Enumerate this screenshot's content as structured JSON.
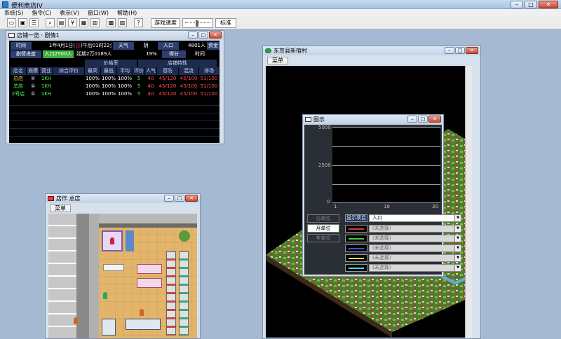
{
  "app": {
    "title": "便利商店IV"
  },
  "menu": [
    "系统(S)",
    "指令(C)",
    "表示(V)",
    "窗口(W)",
    "帮助(H)"
  ],
  "toolbar": {
    "icons": [
      "new-file-icon",
      "save-icon",
      "stats-icon",
      "search-icon",
      "card-icon",
      "money-icon",
      "register-icon",
      "calendar-icon",
      "chart-icon",
      "image-icon",
      "help-icon"
    ],
    "speed_label": "游戏速度",
    "speed_value": "标准",
    "help_glyph": "?"
  },
  "store_list": {
    "title": "店铺一览 · 剧情1",
    "row1": {
      "time_label": "时间",
      "date": "1年4月1日(",
      "weekday": "日",
      "time": ")午后01时22分",
      "weather_label": "天气",
      "weather": "阴",
      "pop_label": "人口",
      "pop": "4801人",
      "fund_label": "资金"
    },
    "row2": {
      "progress_label": "剧情进度",
      "progress_text": "入口2500人",
      "target": "延期2万0189人",
      "pct": "19%",
      "score_label": "得分",
      "time2_label": "时间"
    },
    "group1": "价格率",
    "group2": "店铺特性",
    "columns": [
      "店名",
      "规模",
      "营业",
      "综合评价",
      "最高",
      "最低",
      "平均",
      "评价",
      "人气",
      "容防",
      "混流",
      "排场"
    ],
    "rows": [
      [
        "总店",
        "①",
        "1KH",
        "",
        "100%",
        "100%",
        "100%",
        "5",
        "40",
        "45/120",
        "45/100",
        "51/100"
      ],
      [
        "总店",
        "①",
        "1KH",
        "",
        "100%",
        "100%",
        "100%",
        "5",
        "40",
        "45/120",
        "45/100",
        "51/100"
      ],
      [
        "2号店",
        "①",
        "1KH",
        "",
        "100%",
        "100%",
        "100%",
        "5",
        "40",
        "45/120",
        "45/100",
        "51/100"
      ]
    ]
  },
  "store_window": {
    "title": "店作 总店",
    "menu": "菜单"
  },
  "city_window": {
    "title": "东京县新宿村",
    "menu": "菜单"
  },
  "graph": {
    "title": "图示",
    "y_ticks": [
      "5000",
      "2500",
      "0"
    ],
    "x_ticks": [
      "1",
      "16",
      "30"
    ],
    "units": [
      "日单位",
      "月单位",
      "年单位"
    ],
    "display_label": "显示项目",
    "items": [
      "人口",
      "(未选择)",
      "(未选择)",
      "(未选择)",
      "(未选择)",
      "(未选择)"
    ],
    "item_colors": [
      "#e03a3a",
      "#3ad23a",
      "#3a55e0",
      "#e0e03a",
      "#3ae0e0",
      "#e03ae0"
    ]
  }
}
